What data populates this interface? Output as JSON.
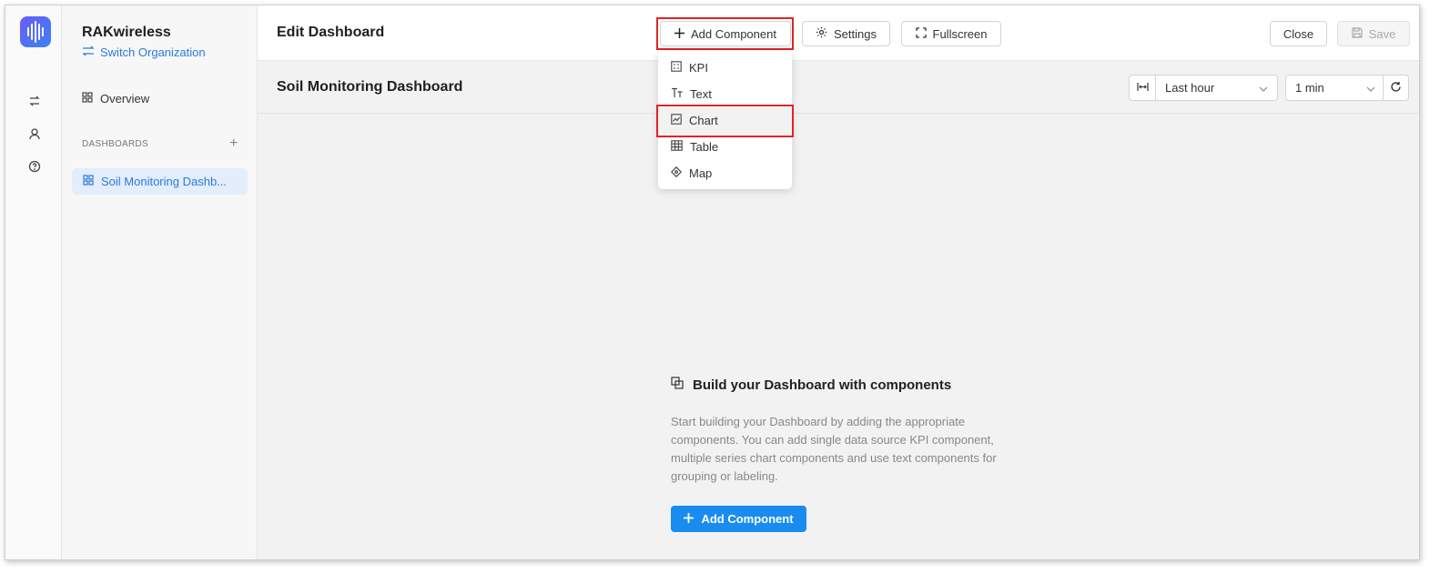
{
  "app": {
    "logo": "rakwireless-logo"
  },
  "rail": {
    "icons": [
      "swap-icon",
      "user-icon",
      "help-icon"
    ]
  },
  "sidebar": {
    "org_name": "RAKwireless",
    "switch_label": "Switch Organization",
    "overview_label": "Overview",
    "dashboards_header": "DASHBOARDS",
    "add_symbol": "+",
    "active_dashboard": "Soil Monitoring Dashb..."
  },
  "header": {
    "title": "Edit Dashboard",
    "add_component": "Add Component",
    "settings": "Settings",
    "fullscreen": "Fullscreen",
    "close": "Close",
    "save": "Save"
  },
  "dashboard": {
    "name": "Soil Monitoring Dashboard",
    "time_range": "Last hour",
    "refresh_interval": "1 min"
  },
  "dropdown": {
    "items": [
      {
        "label": "KPI",
        "icon": "kpi-icon"
      },
      {
        "label": "Text",
        "icon": "text-icon"
      },
      {
        "label": "Chart",
        "icon": "chart-icon"
      },
      {
        "label": "Table",
        "icon": "table-icon"
      },
      {
        "label": "Map",
        "icon": "map-icon"
      }
    ],
    "highlighted": "Chart"
  },
  "empty_state": {
    "title": "Build your Dashboard with components",
    "description": "Start building your Dashboard by adding the appropriate components. You can add single data source KPI component, multiple series chart components and use text components for grouping or labeling.",
    "button": "Add Component"
  },
  "colors": {
    "accent": "#2b7bdc",
    "primary_button": "#1a8cf0",
    "highlight": "#e02424"
  }
}
